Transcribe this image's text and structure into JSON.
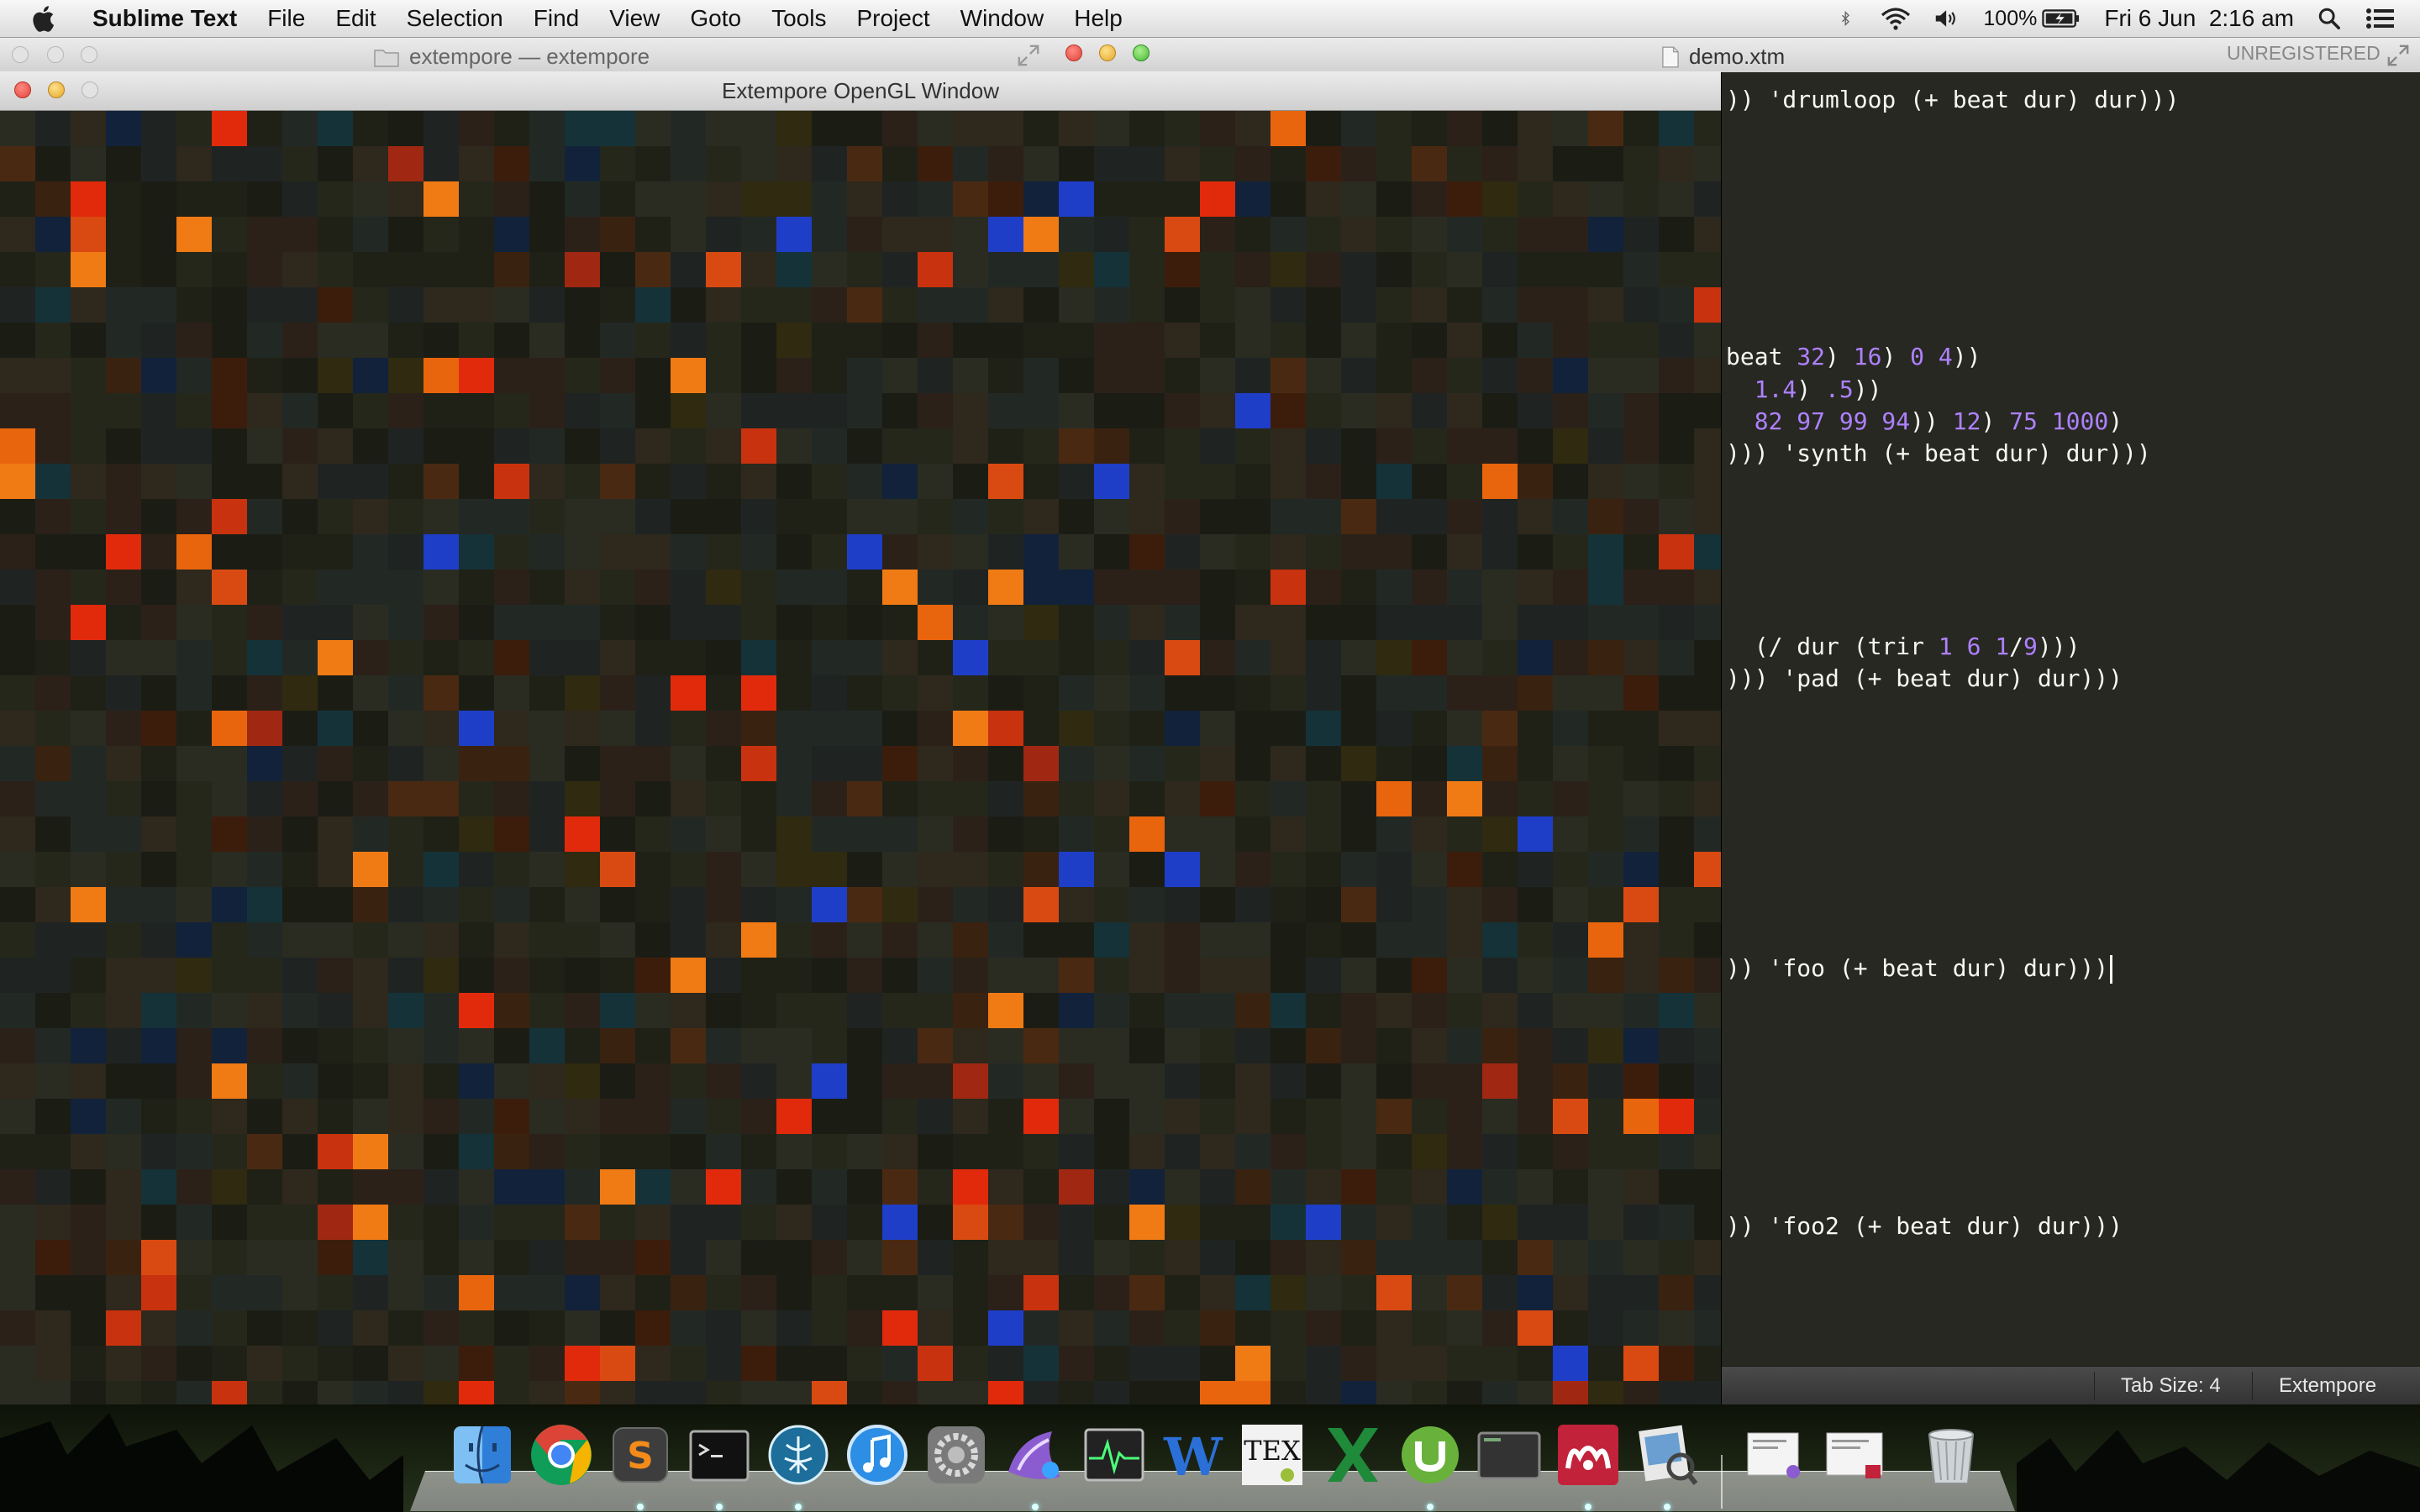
{
  "menubar": {
    "app_name": "Sublime Text",
    "menus": [
      "File",
      "Edit",
      "Selection",
      "Find",
      "View",
      "Goto",
      "Tools",
      "Project",
      "Window",
      "Help"
    ],
    "battery": "100%",
    "clock": "Fri 6 Jun  2:16 am",
    "icons": [
      "apple-icon",
      "bluetooth-icon",
      "wifi-icon",
      "volume-icon",
      "battery-icon",
      "spotlight-icon",
      "notification-center-icon"
    ]
  },
  "sublime_back_window": {
    "title": "extempore — extempore"
  },
  "sublime_window": {
    "file_name": "demo.xtm",
    "license": "UNREGISTERED"
  },
  "gl_window": {
    "title": "Extempore OpenGL Window"
  },
  "editor": {
    "lines": [
      {
        "row": 0,
        "segments": [
          {
            "t": ")) 'drumloop (+ beat dur) dur)))",
            "c": "txt"
          }
        ]
      },
      {
        "row": 8,
        "segments": [
          {
            "t": "beat ",
            "c": "txt"
          },
          {
            "t": "32",
            "c": "num"
          },
          {
            "t": ") ",
            "c": "txt"
          },
          {
            "t": "16",
            "c": "num"
          },
          {
            "t": ") ",
            "c": "txt"
          },
          {
            "t": "0",
            "c": "num"
          },
          {
            "t": " ",
            "c": "txt"
          },
          {
            "t": "4",
            "c": "num"
          },
          {
            "t": "))",
            "c": "txt"
          }
        ]
      },
      {
        "row": 9,
        "segments": [
          {
            "t": "  ",
            "c": "txt"
          },
          {
            "t": "1.4",
            "c": "num"
          },
          {
            "t": ") ",
            "c": "txt"
          },
          {
            "t": ".5",
            "c": "num"
          },
          {
            "t": "))",
            "c": "txt"
          }
        ]
      },
      {
        "row": 10,
        "segments": [
          {
            "t": "  ",
            "c": "txt"
          },
          {
            "t": "82 97 99 94",
            "c": "num"
          },
          {
            "t": ")) ",
            "c": "txt"
          },
          {
            "t": "12",
            "c": "num"
          },
          {
            "t": ") ",
            "c": "txt"
          },
          {
            "t": "75 1000",
            "c": "num"
          },
          {
            "t": ")",
            "c": "txt"
          }
        ]
      },
      {
        "row": 11,
        "segments": [
          {
            "t": "))) 'synth (+ beat dur) dur)))",
            "c": "txt"
          }
        ]
      },
      {
        "row": 17,
        "segments": [
          {
            "t": "  (/ dur (trir ",
            "c": "txt"
          },
          {
            "t": "1",
            "c": "num"
          },
          {
            "t": " ",
            "c": "txt"
          },
          {
            "t": "6",
            "c": "num"
          },
          {
            "t": " ",
            "c": "txt"
          },
          {
            "t": "1",
            "c": "num"
          },
          {
            "t": "/",
            "c": "txt"
          },
          {
            "t": "9",
            "c": "num"
          },
          {
            "t": ")))",
            "c": "txt"
          }
        ]
      },
      {
        "row": 18,
        "segments": [
          {
            "t": "))) 'pad (+ beat dur) dur)))",
            "c": "txt"
          }
        ]
      },
      {
        "row": 27,
        "segments": [
          {
            "t": ")) 'foo (+ beat dur) dur))",
            "c": "txt"
          },
          {
            "t": ")",
            "c": "cursor"
          }
        ]
      },
      {
        "row": 35,
        "segments": [
          {
            "t": ")) 'foo2 (+ beat dur) dur)))",
            "c": "txt"
          }
        ]
      }
    ]
  },
  "statusbar": {
    "tab_size": "Tab Size: 4",
    "syntax": "Extempore"
  },
  "dock": {
    "apps": [
      "finder-icon",
      "chrome-icon",
      "sublime-text-icon",
      "terminal-icon",
      "brain-app-icon",
      "itunes-icon",
      "system-preferences-icon",
      "transmit-icon",
      "activity-monitor-icon",
      "word-icon",
      "tex-icon",
      "excel-icon",
      "utorrent-icon",
      "console-icon",
      "mendeley-icon",
      "preview-icon",
      "document-stack-icon",
      "document-stack-icon",
      "trash-icon"
    ],
    "colors": {
      "finder": "#3b8ee8",
      "chrome_red": "#db4437",
      "chrome_yellow": "#f4b400",
      "chrome_green": "#0f9d58",
      "sublime": "#f28b1a",
      "itunes": "#2d8ee6",
      "utorrent": "#68b23c",
      "excel": "#1e8a3a",
      "word": "#2b70d8",
      "mendeley": "#c3223b"
    }
  },
  "palette": {
    "editor_bg": "#272822",
    "code_text": "#f8f8f2",
    "code_number": "#ae81ff",
    "grid_red": "#e12a0c",
    "grid_orange": "#e8650d",
    "grid_blue": "#1e3ec8"
  }
}
